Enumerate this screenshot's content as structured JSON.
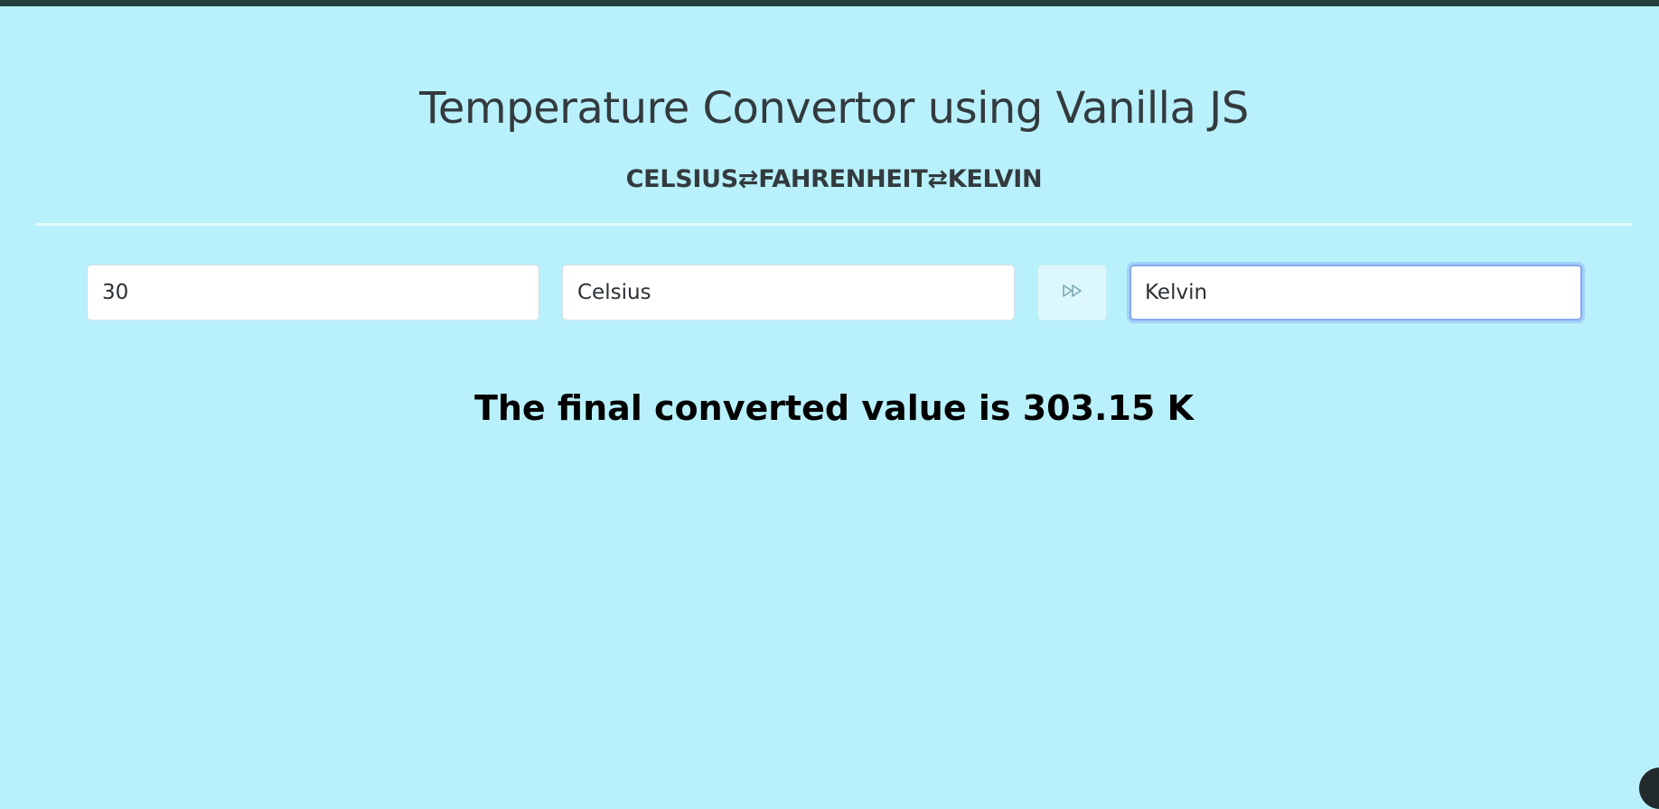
{
  "page": {
    "title": "Temperature Convertor using Vanilla JS",
    "subtitle": "CELSIUS⇄FAHRENHEIT⇄KELVIN"
  },
  "form": {
    "value_input": "30",
    "from_unit": "Celsius",
    "convert_button_icon": "fast-forward-icon",
    "to_unit": "Kelvin"
  },
  "result": {
    "text": "The final converted value is 303.15 K"
  },
  "colors": {
    "background": "#b8f1fc",
    "topbar": "#23403f",
    "text": "#333a3e",
    "focus_border": "#86a8f0"
  }
}
